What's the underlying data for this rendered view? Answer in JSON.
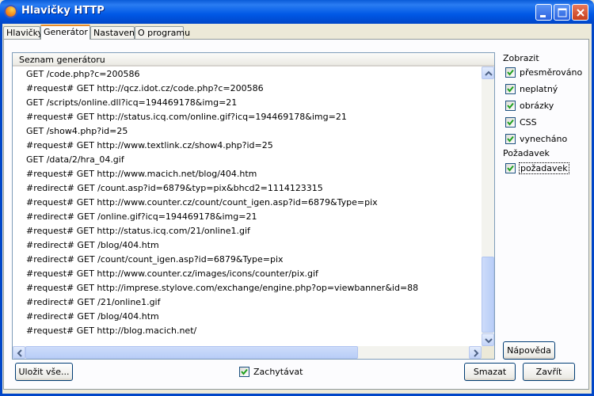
{
  "window": {
    "title": "Hlavičky HTTP",
    "app_icon": "firefox-icon",
    "controls": [
      "minimize-icon",
      "maximize-icon",
      "close-icon"
    ]
  },
  "tabs": [
    {
      "label": "Hlavičky"
    },
    {
      "label": "Generátor",
      "active": true
    },
    {
      "label": "Nastavení"
    },
    {
      "label": "O programu"
    }
  ],
  "generator_list": {
    "header": "Seznam generátoru",
    "rows": [
      "GET /code.php?c=200586",
      "#request# GET http://qcz.idot.cz/code.php?c=200586",
      "GET /scripts/online.dll?icq=194469178&img=21",
      "#request# GET http://status.icq.com/online.gif?icq=194469178&img=21",
      "GET /show4.php?id=25",
      "#request# GET http://www.textlink.cz/show4.php?id=25",
      "GET /data/2/hra_04.gif",
      "#request# GET http://www.macich.net/blog/404.htm",
      "#redirect# GET /count.asp?id=6879&typ=pix&bhcd2=1114123315",
      "#request# GET http://www.counter.cz/count/count_igen.asp?id=6879&Type=pix",
      "#redirect# GET /online.gif?icq=194469178&img=21",
      "#request# GET http://status.icq.com/21/online1.gif",
      "#redirect# GET /blog/404.htm",
      "#redirect# GET /count/count_igen.asp?id=6879&Type=pix",
      "#request# GET http://www.counter.cz/images/icons/counter/pix.gif",
      "#request# GET http://imprese.stylove.com/exchange/engine.php?op=viewbanner&id=88",
      "#redirect# GET /21/online1.gif",
      "#redirect# GET /blog/404.htm",
      "#request# GET http://blog.macich.net/"
    ]
  },
  "filters": {
    "zobrazit_label": "Zobrazit",
    "zobrazit": [
      {
        "label": "přesměrováno",
        "checked": true
      },
      {
        "label": "neplatný",
        "checked": true
      },
      {
        "label": "obrázky",
        "checked": true
      },
      {
        "label": "CSS",
        "checked": true
      },
      {
        "label": "vynecháno",
        "checked": true
      }
    ],
    "pozadavek_label": "Požadavek",
    "pozadavek": [
      {
        "label": "požadavek",
        "checked": true
      }
    ]
  },
  "buttons": {
    "help": "Nápověda",
    "save_all": "Uložit vše...",
    "delete": "Smazat",
    "close": "Zavřít"
  },
  "capture": {
    "label": "Zachytávat",
    "checked": true
  },
  "colors": {
    "titlebar": "#0058e6",
    "tab_highlight": "#e68b2c",
    "dialog_bg": "#ece9d8"
  }
}
